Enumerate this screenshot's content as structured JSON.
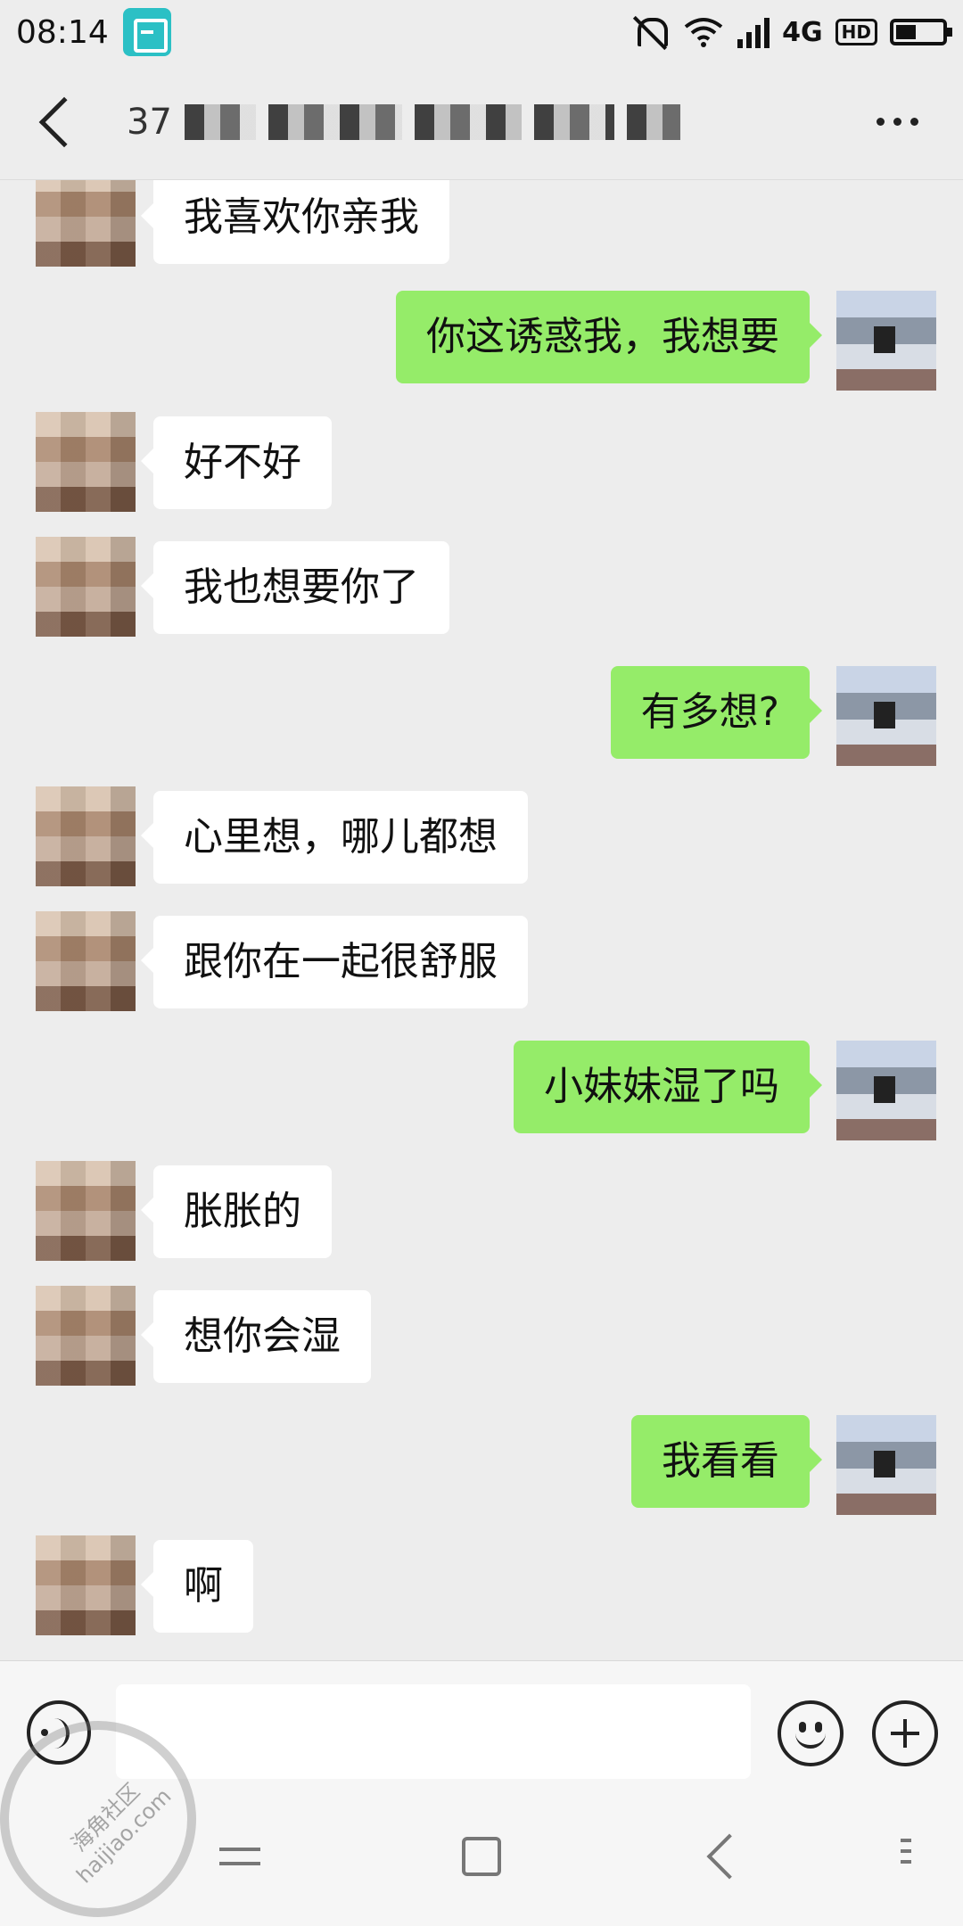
{
  "status_bar": {
    "time": "08:14",
    "network": "4G",
    "hd": "HD",
    "icons": [
      "scan-icon",
      "bell-off-icon",
      "wifi-icon",
      "signal-icon",
      "battery-icon"
    ]
  },
  "header": {
    "back_icon": "back-icon",
    "unread_count": "37",
    "more_icon": "more-icon"
  },
  "messages": [
    {
      "side": "left",
      "text": "我喜欢你亲我"
    },
    {
      "side": "right",
      "text": "你这诱惑我，我想要"
    },
    {
      "side": "left",
      "text": "好不好"
    },
    {
      "side": "left",
      "text": "我也想要你了"
    },
    {
      "side": "right",
      "text": "有多想?"
    },
    {
      "side": "left",
      "text": "心里想，哪儿都想"
    },
    {
      "side": "left",
      "text": "跟你在一起很舒服"
    },
    {
      "side": "right",
      "text": "小妹妹湿了吗"
    },
    {
      "side": "left",
      "text": "胀胀的"
    },
    {
      "side": "left",
      "text": "想你会湿"
    },
    {
      "side": "right",
      "text": "我看看"
    },
    {
      "side": "left",
      "text": "啊"
    }
  ],
  "input_bar": {
    "voice_icon": "voice-icon",
    "input_value": "",
    "emoji_icon": "emoji-icon",
    "plus_icon": "plus-icon"
  },
  "nav_bar": {
    "icons": [
      "switch-icon",
      "home-icon",
      "back-icon",
      "menu-icon"
    ]
  },
  "watermark": {
    "line1": "海角社区",
    "line2": "haijiao.com"
  },
  "colors": {
    "background": "#ededed",
    "sent_bubble": "#95ec69",
    "received_bubble": "#ffffff",
    "scan_icon": "#2bc0c5"
  }
}
